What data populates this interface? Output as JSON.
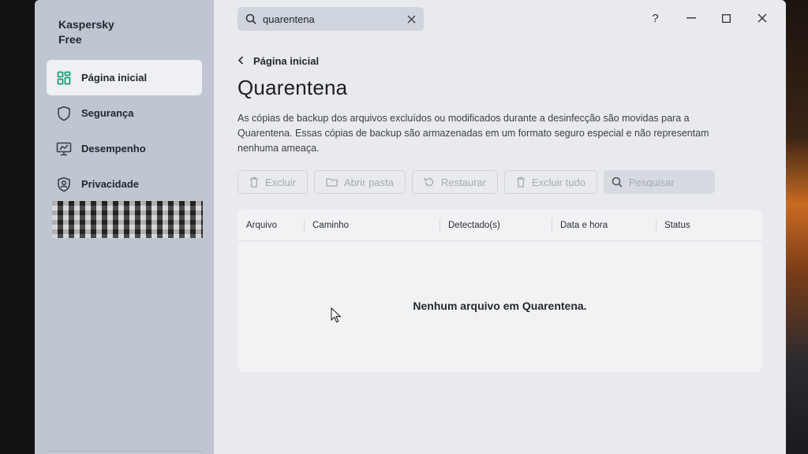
{
  "app": {
    "brand": "Kaspersky\nFree"
  },
  "sidebar": {
    "items": [
      {
        "label": "Página inicial",
        "icon": "home-grid-icon",
        "active": true
      },
      {
        "label": "Segurança",
        "icon": "shield-icon",
        "active": false
      },
      {
        "label": "Desempenho",
        "icon": "monitor-gauge-icon",
        "active": false
      },
      {
        "label": "Privacidade",
        "icon": "privacy-shield-icon",
        "active": false
      }
    ]
  },
  "topbar": {
    "search_value": "quarentena",
    "help_label": "?",
    "minimize_label": "—",
    "maximize_label": "☐",
    "close_label": "✕"
  },
  "page": {
    "back_label": "Página inicial",
    "title": "Quarentena",
    "description": "As cópias de backup dos arquivos excluídos ou modificados durante a desinfecção são movidas para a Quarentena. Essas cópias de backup são armazenadas em um formato seguro especial e não representam nenhuma ameaça."
  },
  "toolbar": {
    "delete_label": "Excluir",
    "open_folder_label": "Abrir pasta",
    "restore_label": "Restaurar",
    "delete_all_label": "Excluir tudo",
    "search_placeholder": "Pesquisar"
  },
  "table": {
    "columns": [
      "Arquivo",
      "Caminho",
      "Detectado(s)",
      "Data e hora",
      "Status"
    ],
    "empty_message": "Nenhum arquivo em Quarentena."
  },
  "colors": {
    "sidebar_bg": "#bfc6d1",
    "main_bg": "#e9eaee",
    "accent_green": "#1f9a7a"
  }
}
